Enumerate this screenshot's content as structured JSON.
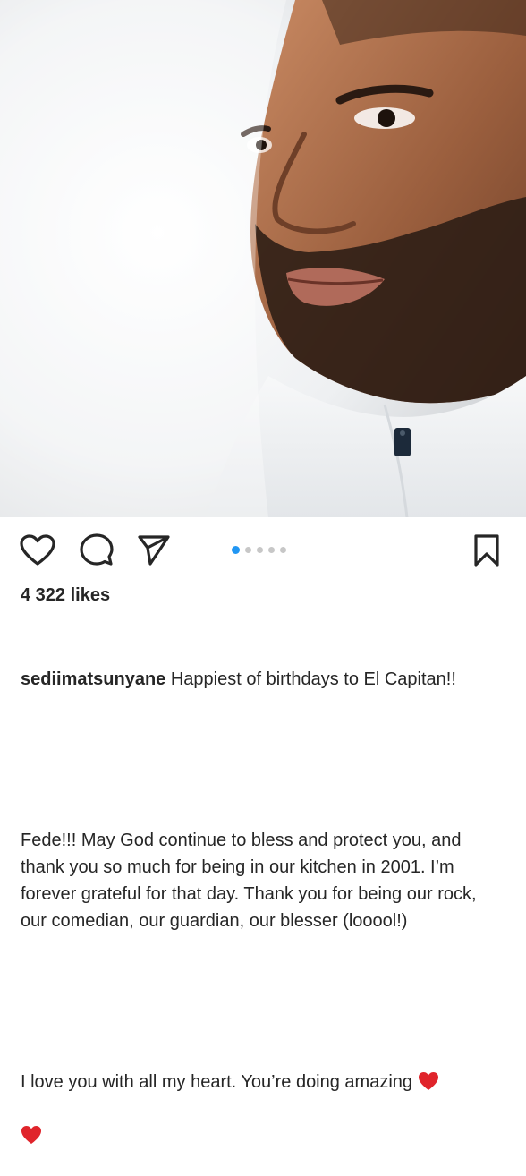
{
  "post": {
    "likes": "4 322 likes",
    "username": "sediimatsunyane",
    "caption_line1": " Happiest of birthdays to El Capitan!!",
    "caption_para2": "Fede!!! May God continue to bless and protect you, and thank you so much for being in our kitchen in 2001. I’m forever grateful for that day. Thank you for being our rock, our comedian, our guardian, our blesser (looool!)",
    "caption_para3": "I love you with all my heart. You’re doing amazing ",
    "emoji": "red-heart",
    "carousel": {
      "total": 5,
      "active": 1,
      "active_color": "#2196f3"
    }
  },
  "icons": {
    "like": "heart-outline-icon",
    "comment": "comment-bubble-icon",
    "share": "paper-plane-icon",
    "save": "bookmark-icon"
  },
  "colors": {
    "text": "#262626",
    "heart": "#e0242b"
  }
}
